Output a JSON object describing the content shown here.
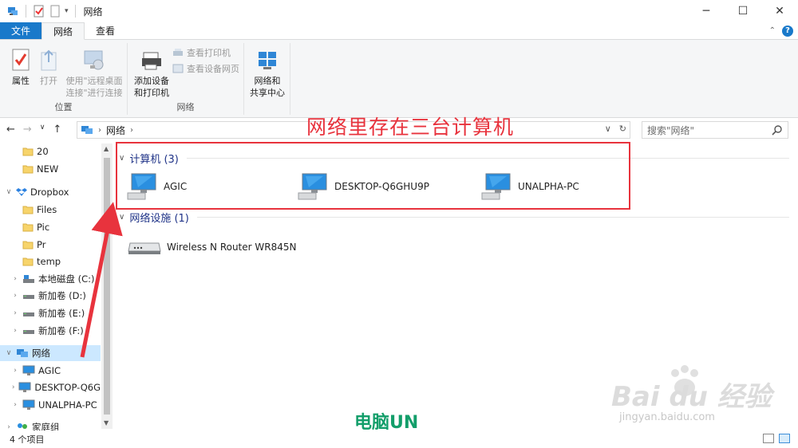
{
  "window": {
    "title": "网络",
    "minimize": "─",
    "maximize": "☐",
    "close": "✕"
  },
  "ribbon_tabs": [
    {
      "label": "文件"
    },
    {
      "label": "网络"
    },
    {
      "label": "查看"
    }
  ],
  "ribbon": {
    "location_group": {
      "label": "位置",
      "properties": "属性",
      "open": "打开",
      "remote_line1": "使用\"远程桌面",
      "remote_line2": "连接\"进行连接"
    },
    "network_group": {
      "label": "网络",
      "add_line1": "添加设备",
      "add_line2": "和打印机",
      "view_printers": "查看打印机",
      "view_device_page": "查看设备网页"
    },
    "center_group": {
      "line1": "网络和",
      "line2": "共享中心"
    }
  },
  "address": {
    "path": "网络",
    "search_placeholder": "搜索\"网络\""
  },
  "annotation": {
    "title": "网络里存在三台计算机",
    "watermark": "电脑UN"
  },
  "baidu_watermark": {
    "main": "Bai du 经验",
    "sub": "jingyan.baidu.com"
  },
  "nav": {
    "items": [
      {
        "label": "20",
        "type": "folder"
      },
      {
        "label": "NEW",
        "type": "folder"
      },
      {
        "label": "Dropbox",
        "type": "dropbox"
      },
      {
        "label": "Files",
        "type": "folder"
      },
      {
        "label": "Pic",
        "type": "folder"
      },
      {
        "label": "Pr",
        "type": "folder"
      },
      {
        "label": "temp",
        "type": "folder"
      },
      {
        "label": "本地磁盘 (C:)",
        "type": "drive-c"
      },
      {
        "label": "新加卷 (D:)",
        "type": "drive"
      },
      {
        "label": "新加卷 (E:)",
        "type": "drive"
      },
      {
        "label": "新加卷 (F:)",
        "type": "drive"
      },
      {
        "label": "网络",
        "type": "network"
      },
      {
        "label": "AGIC",
        "type": "computer"
      },
      {
        "label": "DESKTOP-Q6G",
        "type": "computer"
      },
      {
        "label": "UNALPHA-PC",
        "type": "computer"
      },
      {
        "label": "家庭组",
        "type": "homegroup"
      }
    ]
  },
  "content": {
    "computers_group": "计算机 (3)",
    "computers": [
      "AGIC",
      "DESKTOP-Q6GHU9P",
      "UNALPHA-PC"
    ],
    "infra_group": "网络设施 (1)",
    "devices": [
      "Wireless N Router WR845N"
    ]
  },
  "status": {
    "count": "4 个项目"
  },
  "colors": {
    "accent": "#1979ca",
    "annotation": "#e8333d",
    "watermark": "#139e6a",
    "selection": "#cce8ff"
  }
}
